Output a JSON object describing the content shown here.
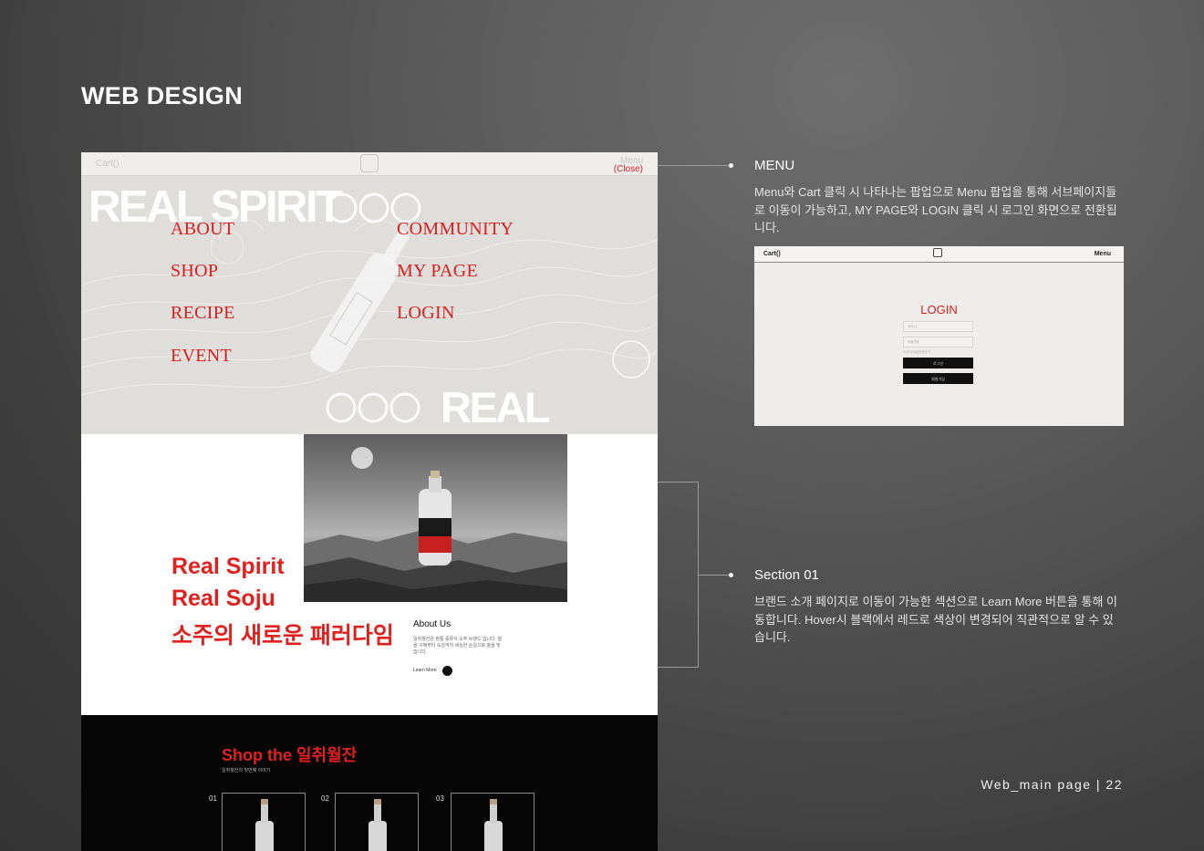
{
  "page": {
    "title": "WEB DESIGN"
  },
  "menu_popup": {
    "cart": "Cart()",
    "menu": "Menu",
    "close": "(Close)",
    "hero_top": "REAL SPIRIT",
    "hero_bottom": "REAL SOJU",
    "left_items": [
      "ABOUT",
      "SHOP",
      "RECIPE",
      "EVENT"
    ],
    "right_items": [
      "COMMUNITY",
      "MY PAGE",
      "LOGIN"
    ]
  },
  "section01": {
    "headline": [
      "Real Spirit",
      "Real Soju",
      "소주의 새로운 패러다임"
    ],
    "about_title": "About Us",
    "about_body": "일취월잔은 정통 증류식 소주 브랜드 입니다. 쌀을 구매부터 숙성까지 세심한 손길으로 술을 빚습니다.",
    "learn_more": "Learn More"
  },
  "shop": {
    "title": "Shop the 일취월잔",
    "subtitle": "일취월잔의 첫번째 이야기",
    "cards": [
      {
        "num": "01"
      },
      {
        "num": "02"
      },
      {
        "num": "03"
      }
    ]
  },
  "annotations": {
    "menu": {
      "title": "MENU",
      "body": "Menu와 Cart 클릭 시 나타나는 팝업으로 Menu 팝업을 통해 서브페이지들로 이동이 가능하고, MY PAGE와 LOGIN 클릭 시 로그인 화면으로 전환됩니다."
    },
    "section01": {
      "title": "Section 01",
      "body": "브랜드 소개 페이지로 이동이 가능한 섹션으로 Learn More 버튼을 통해 이동합니다. Hover시 블랙에서 레드로 색상이 변경되어 직관적으로 알 수 있습니다."
    }
  },
  "login_screen": {
    "cart": "Cart()",
    "menu": "Menu",
    "title": "LOGIN",
    "id_placeholder": "아이디",
    "pw_placeholder": "비밀번호",
    "find": "아이디/비밀번호찾기",
    "login_button": "로그인",
    "join_button": "회원가입"
  },
  "footer": {
    "label": "Web_main page  |  22"
  },
  "colors": {
    "accent_red": "#e2201d",
    "background": "#5a5a5a",
    "menu_bg": "#e0dedb"
  }
}
